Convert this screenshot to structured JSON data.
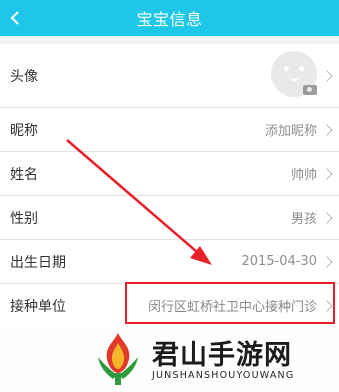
{
  "header": {
    "title": "宝宝信息",
    "back_icon": "chevron-left-icon"
  },
  "rows": [
    {
      "label": "头像",
      "value": ""
    },
    {
      "label": "昵称",
      "value": "添加昵称"
    },
    {
      "label": "姓名",
      "value": "帅帅"
    },
    {
      "label": "性别",
      "value": "男孩"
    },
    {
      "label": "出生日期",
      "value": "2015-04-30"
    },
    {
      "label": "接种单位",
      "value": "闵行区虹桥社卫中心接种门诊"
    }
  ],
  "annotation": {
    "color": "#e8202a"
  },
  "watermark": {
    "title": "君山手游网",
    "subtitle": "JUNSHANSHOUYOUWANG"
  },
  "colors": {
    "header": "#1ec6e8",
    "background": "#f2f2f2"
  }
}
